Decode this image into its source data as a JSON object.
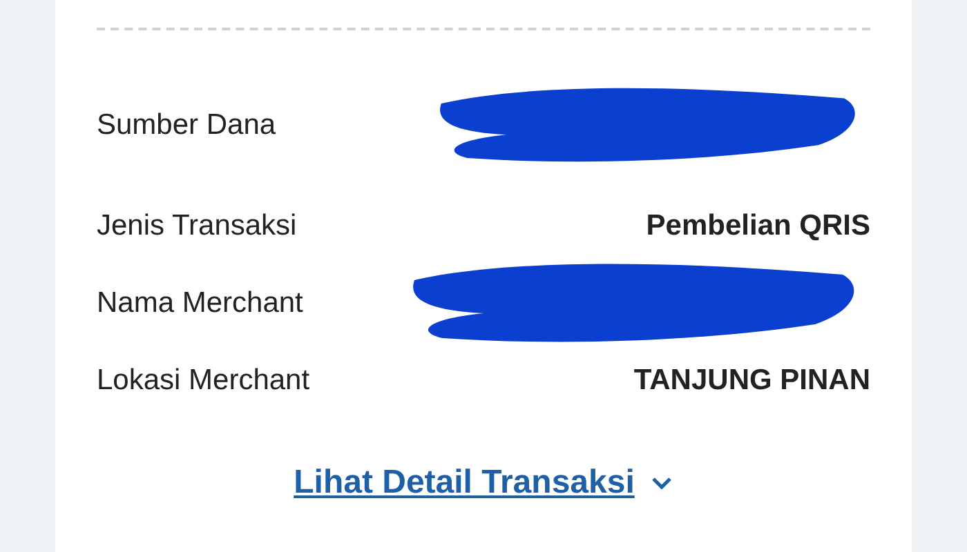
{
  "details": [
    {
      "label": "Sumber Dana",
      "redacted": true
    },
    {
      "label": "Jenis Transaksi",
      "value": "Pembelian QRIS",
      "redacted": false
    },
    {
      "label": "Nama Merchant",
      "redacted": true
    },
    {
      "label": "Lokasi Merchant",
      "value": "TANJUNG PINAN",
      "redacted": false
    }
  ],
  "detail_link": {
    "label": "Lihat Detail Transaksi",
    "expanded": false
  }
}
